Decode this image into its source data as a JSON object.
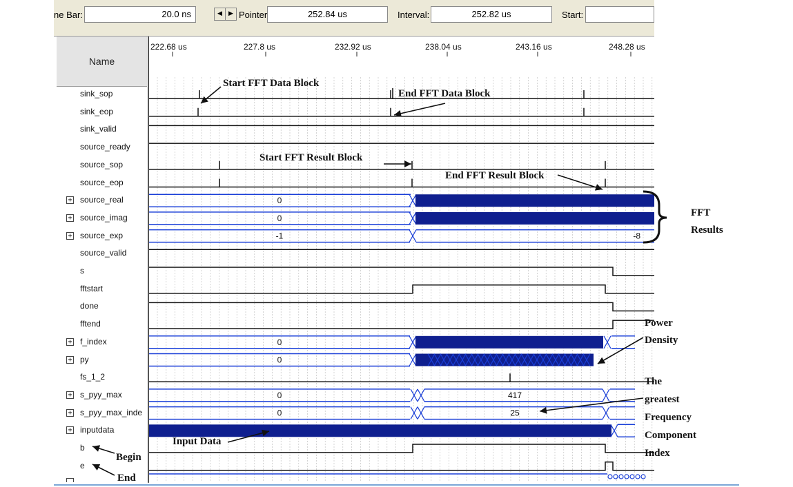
{
  "toolbar": {
    "timebar_label": "ne Bar:",
    "timebar_value": "20.0 ns",
    "pointer_label": "Pointer:",
    "pointer_value": "252.84 us",
    "interval_label": "Interval:",
    "interval_value": "252.82 us",
    "start_label": "Start:",
    "start_value": ""
  },
  "name_header": "Name",
  "time_ticks": [
    "222.68 us",
    "227.8 us",
    "232.92 us",
    "238.04 us",
    "243.16 us",
    "248.28 us"
  ],
  "signals": [
    {
      "name": "sink_sop",
      "bus": false
    },
    {
      "name": "sink_eop",
      "bus": false
    },
    {
      "name": "sink_valid",
      "bus": false
    },
    {
      "name": "source_ready",
      "bus": false
    },
    {
      "name": "source_sop",
      "bus": false
    },
    {
      "name": "source_eop",
      "bus": false
    },
    {
      "name": "source_real",
      "bus": true
    },
    {
      "name": "source_imag",
      "bus": true
    },
    {
      "name": "source_exp",
      "bus": true
    },
    {
      "name": "source_valid",
      "bus": false
    },
    {
      "name": "s",
      "bus": false
    },
    {
      "name": "fftstart",
      "bus": false
    },
    {
      "name": "done",
      "bus": false
    },
    {
      "name": "fftend",
      "bus": false
    },
    {
      "name": "f_index",
      "bus": true
    },
    {
      "name": "py",
      "bus": true
    },
    {
      "name": "fs_1_2",
      "bus": false
    },
    {
      "name": "s_pyy_max",
      "bus": true
    },
    {
      "name": "s_pyy_max_inde",
      "bus": true
    },
    {
      "name": "inputdata",
      "bus": true
    },
    {
      "name": "b",
      "bus": false
    },
    {
      "name": "e",
      "bus": false
    }
  ],
  "bus_values": {
    "source_real_initial": "0",
    "source_imag_initial": "0",
    "source_exp_initial": "-1",
    "source_exp_final": "-8",
    "f_index_initial": "0",
    "py_initial": "0",
    "s_pyy_max_initial": "0",
    "s_pyy_max_final": "417",
    "s_pyy_max_inde_initial": "0",
    "s_pyy_max_inde_final": "25"
  },
  "annotations": {
    "start_fft_data_block": "Start FFT Data Block",
    "end_fft_data_block": "End FFT Data Block",
    "start_fft_result_block": "Start FFT Result Block",
    "end_fft_result_block": "End FFT Result Block",
    "fft": "FFT",
    "results": "Results",
    "power": "Power",
    "density": "Density",
    "the": "The",
    "greatest": "greatest",
    "frequency": "Frequency",
    "component": "Component",
    "index": "Index",
    "input_data": "Input Data",
    "begin": "Begin",
    "end": "End"
  },
  "colors": {
    "bus_fill": "#0f1f8f",
    "bus_line": "#1a3fd8",
    "grid": "#b8b8b8",
    "toolbar_bg": "#ece9d8"
  }
}
